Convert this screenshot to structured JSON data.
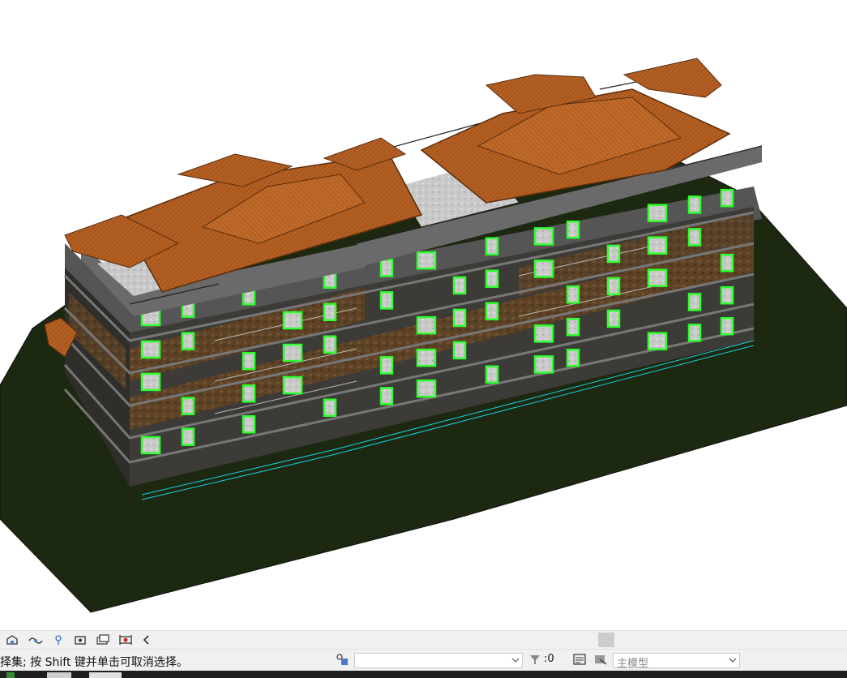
{
  "viewport": {
    "description_icon": "revit-3d-view",
    "colors": {
      "ground": "#1f2a12",
      "roof": "#b05a20",
      "window_frame": "#3aff3a",
      "wall_dark": "#3b3a36",
      "wall_stone": "#6a4a2a",
      "glass": "#d8d8d8"
    }
  },
  "view_control_bar": {
    "icons": [
      "detail-level-icon",
      "visual-style-icon",
      "sun-path-icon",
      "crop-view-icon",
      "show-crop-icon",
      "temporary-hide-icon",
      "collapse-chevron-icon"
    ]
  },
  "status_bar": {
    "message": "选择集; 按 Shift 键并单击可取消选择。",
    "workset_icon": "workset-icon",
    "filter_icon": "filter-icon",
    "selection_count": ":0",
    "design_option_icon": "design-options-icon",
    "editable_icon": "editable-only-icon",
    "model_label": "主模型"
  }
}
